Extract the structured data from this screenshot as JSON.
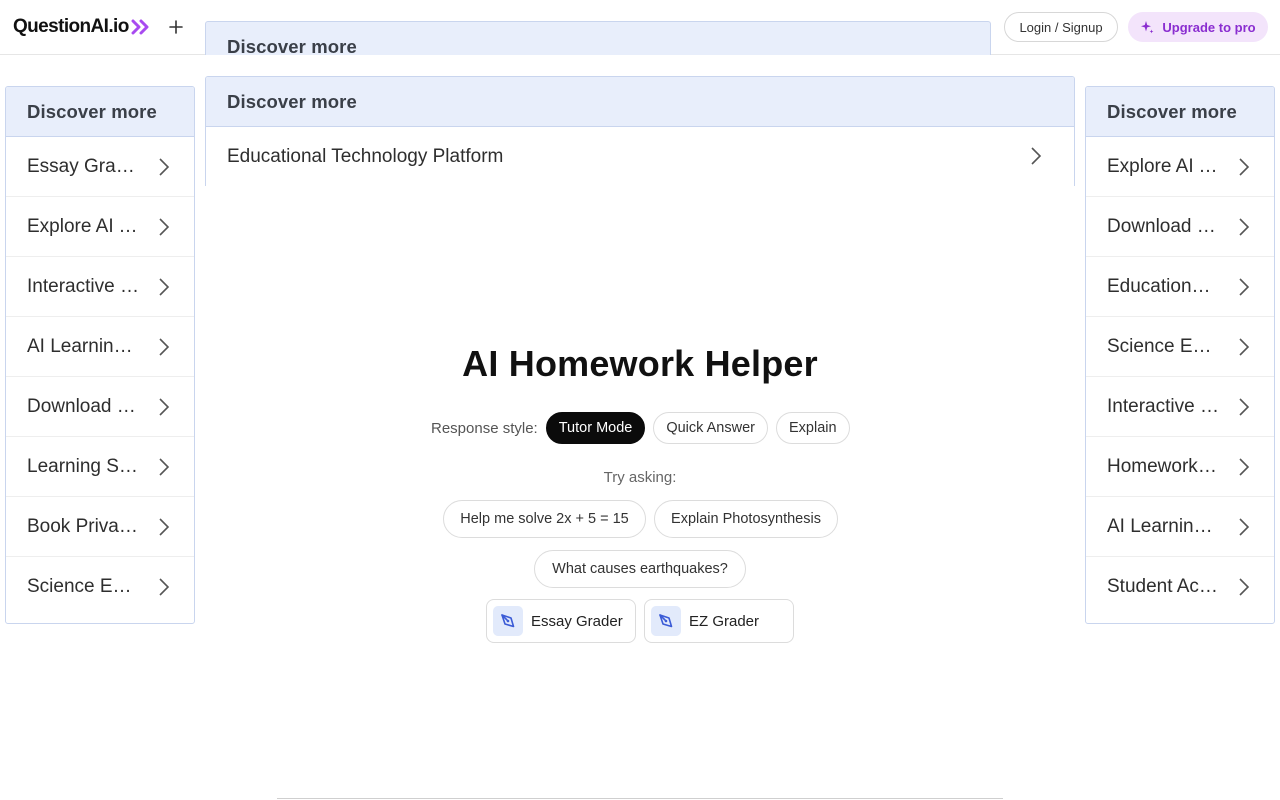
{
  "header": {
    "logo_text": "QuestionAI.io",
    "top_ad_title": "Discover more",
    "login_label": "Login / Signup",
    "upgrade_label": "Upgrade to pro",
    "icons": {
      "logo_chevrons": "double-chevron-right-icon",
      "new": "plus-icon",
      "upgrade": "sparkle-icon"
    },
    "colors": {
      "logo_accent": "#a84bf0",
      "upgrade_bg": "#f3e4fb",
      "upgrade_text": "#8a2dd0"
    }
  },
  "left_ad": {
    "title": "Discover more",
    "items": [
      {
        "label": "Essay Grading"
      },
      {
        "label": "Explore AI Tools"
      },
      {
        "label": "Interactive Learning"
      },
      {
        "label": "AI Learning Tools"
      },
      {
        "label": "Download Resources"
      },
      {
        "label": "Learning Support"
      },
      {
        "label": "Book Private Tutor"
      },
      {
        "label": "Science Experiments"
      }
    ]
  },
  "center_ad": {
    "title": "Discover more",
    "items": [
      {
        "label": "Educational Technology Platform"
      }
    ]
  },
  "right_ad": {
    "title": "Discover more",
    "items": [
      {
        "label": "Explore AI Tools"
      },
      {
        "label": "Download Resources"
      },
      {
        "label": "Educational Apps"
      },
      {
        "label": "Science Experiments"
      },
      {
        "label": "Interactive Learning"
      },
      {
        "label": "Homework Help"
      },
      {
        "label": "AI Learning Tools"
      },
      {
        "label": "Student Academic"
      }
    ]
  },
  "main": {
    "title": "AI Homework Helper",
    "response_style_label": "Response style:",
    "styles": [
      {
        "label": "Tutor Mode",
        "active": true
      },
      {
        "label": "Quick Answer",
        "active": false
      },
      {
        "label": "Explain",
        "active": false
      }
    ],
    "try_label": "Try asking:",
    "suggestions": [
      {
        "label": "Help me solve 2x + 5 = 15"
      },
      {
        "label": "Explain Photosynthesis"
      },
      {
        "label": "What causes earthquakes?"
      }
    ],
    "tools": [
      {
        "label": "Essay Grader",
        "icon": "pen-nib-icon"
      },
      {
        "label": "EZ Grader",
        "icon": "pen-nib-icon"
      }
    ]
  }
}
